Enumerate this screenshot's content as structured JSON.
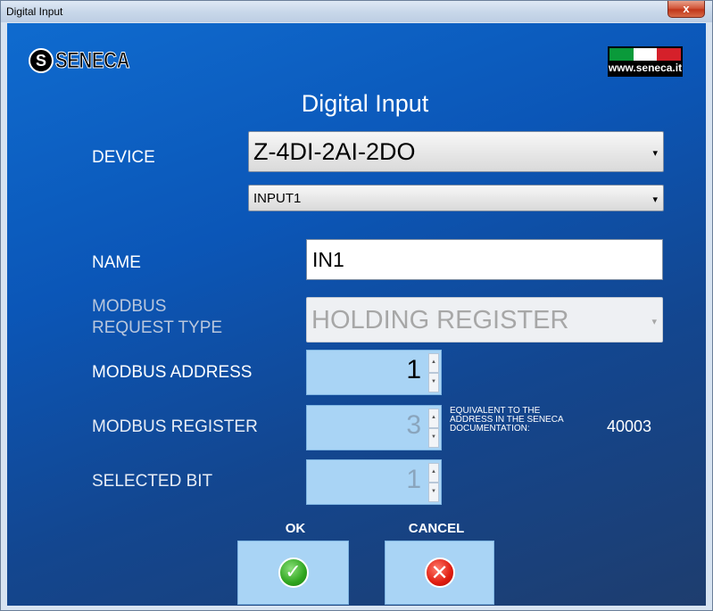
{
  "window": {
    "title": "Digital Input",
    "close_glyph": "x"
  },
  "logo": {
    "mark": "S",
    "text": "SENECA"
  },
  "brand": {
    "url": "www.seneca.it",
    "flag_colors": [
      "#0a9a3a",
      "#ffffff",
      "#d5202a"
    ]
  },
  "heading": "Digital Input",
  "form": {
    "device": {
      "label": "DEVICE",
      "value": "Z-4DI-2AI-2DO"
    },
    "input": {
      "value": "INPUT1"
    },
    "name": {
      "label": "NAME",
      "value": "IN1"
    },
    "request_type": {
      "label_line1": "MODBUS",
      "label_line2": "REQUEST TYPE",
      "value": "HOLDING REGISTER"
    },
    "address": {
      "label": "MODBUS ADDRESS",
      "value": "1"
    },
    "register": {
      "label": "MODBUS REGISTER",
      "value": "3"
    },
    "equivalent": {
      "line1": "EQUIVALENT TO THE",
      "line2": "ADDRESS IN THE SENECA",
      "line3": "DOCUMENTATION:",
      "value": "40003"
    },
    "bit": {
      "label": "SELECTED BIT",
      "value": "1"
    }
  },
  "buttons": {
    "ok_label": "OK",
    "cancel_label": "CANCEL"
  },
  "icons": {
    "ok": "checkmark-icon",
    "cancel": "x-mark-icon",
    "dropdown": "chevron-down-icon"
  },
  "colors": {
    "bg_top": "#0f6bcf",
    "bg_bottom": "#1e3d6e",
    "spin_bg": "#a9d4f5"
  }
}
